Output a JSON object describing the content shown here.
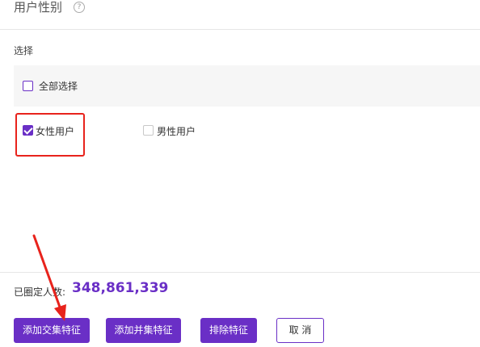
{
  "header": {
    "title": "用户性别",
    "help_glyph": "?"
  },
  "section": {
    "label": "选择"
  },
  "select_all": {
    "label": "全部选择",
    "checked": false
  },
  "options": [
    {
      "label": "女性用户",
      "checked": true
    },
    {
      "label": "男性用户",
      "checked": false
    }
  ],
  "summary": {
    "label": "已圈定人数:",
    "value": "348,861,339"
  },
  "buttons": {
    "intersect": "添加交集特征",
    "union": "添加并集特征",
    "exclude": "排除特征",
    "cancel": "取 消"
  },
  "colors": {
    "accent": "#6a2fc6",
    "annotation": "#e8231c"
  }
}
